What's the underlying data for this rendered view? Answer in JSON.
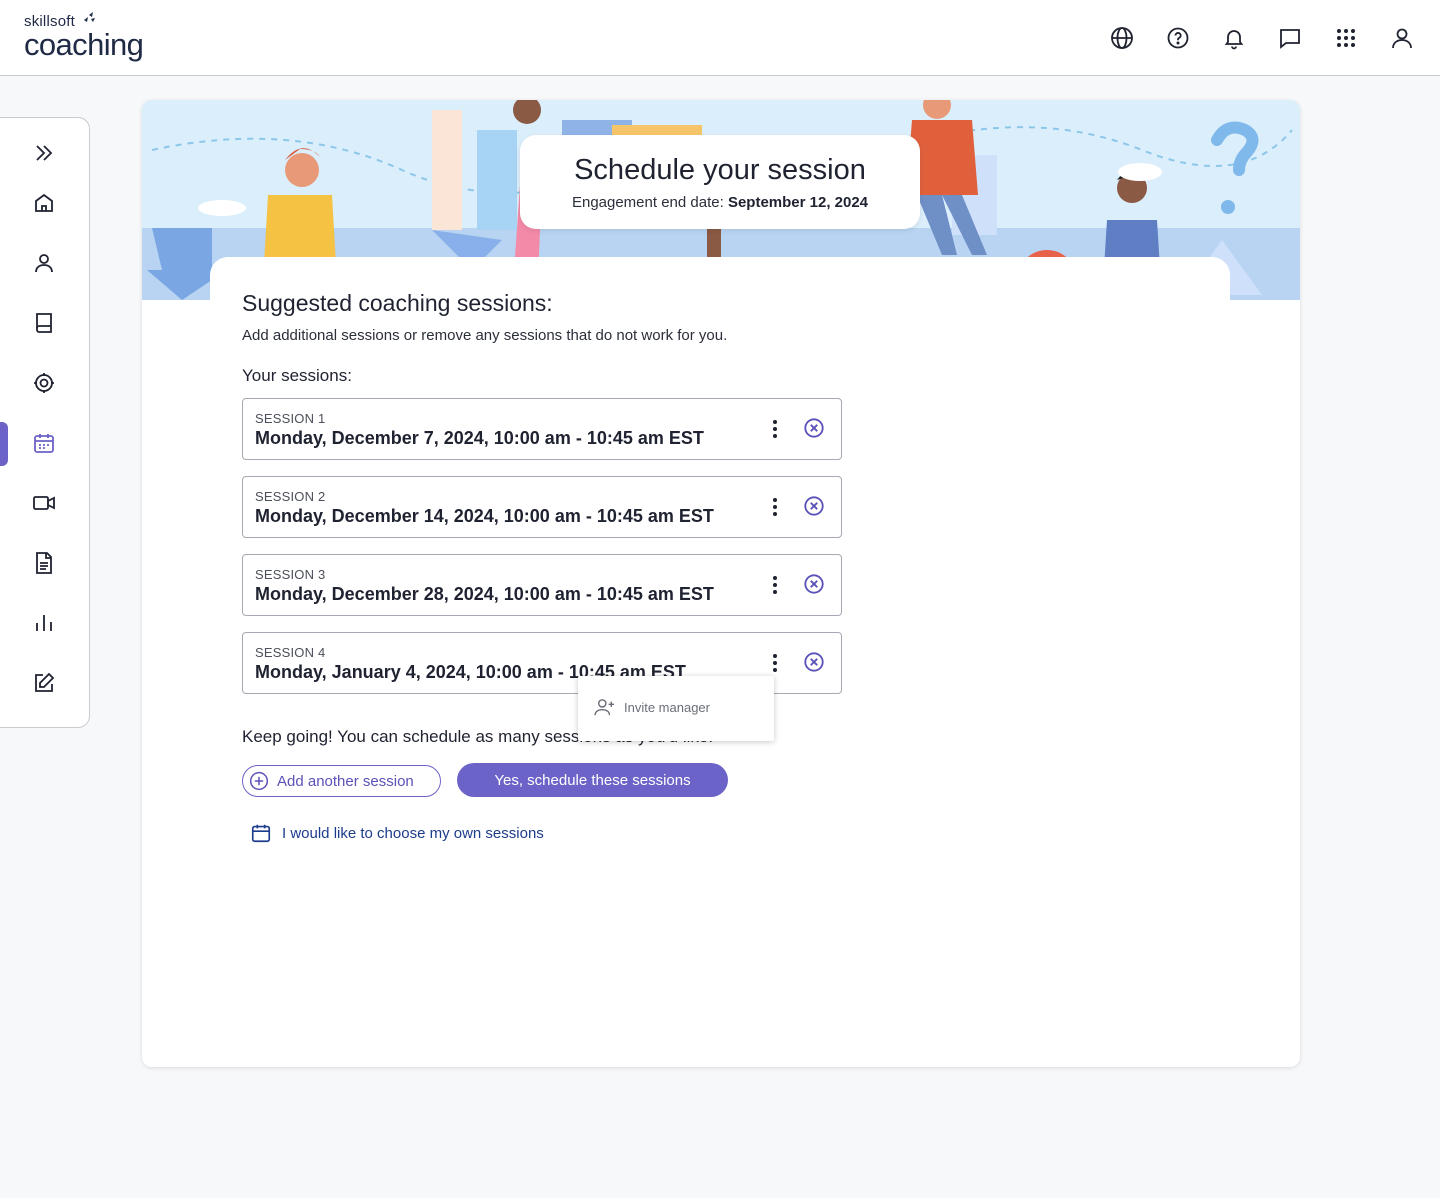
{
  "app": {
    "brand_small": "skillsoft",
    "brand_big": "coaching"
  },
  "topbar": {
    "icons": [
      "globe-icon",
      "help-icon",
      "bell-icon",
      "chat-icon",
      "apps-grid-icon",
      "user-icon"
    ]
  },
  "sidebar": {
    "items": [
      "expand-icon",
      "home-icon",
      "person-icon",
      "book-icon",
      "target-icon",
      "calendar-icon",
      "video-icon",
      "document-icon",
      "chart-icon",
      "edit-icon"
    ],
    "active": "calendar-icon"
  },
  "header": {
    "title": "Schedule your session",
    "engagement_label": "Engagement end date:",
    "engagement_date": "September 12, 2024"
  },
  "main": {
    "heading": "Suggested coaching sessions:",
    "hint": "Add additional sessions or remove any sessions that do not work for you.",
    "your_sessions": "Your sessions:",
    "sessions": [
      {
        "label": "SESSION 1",
        "when": "Monday, December 7, 2024, 10:00 am - 10:45 am EST"
      },
      {
        "label": "SESSION 2",
        "when": "Monday, December 14, 2024, 10:00 am - 10:45 am EST"
      },
      {
        "label": "SESSION 3",
        "when": "Monday, December 28, 2024, 10:00 am - 10:45 am EST"
      },
      {
        "label": "SESSION 4",
        "when": "Monday, January 4, 2024, 10:00 am - 10:45 am EST"
      }
    ],
    "menu_item": "Invite manager",
    "keep_going": "Keep going! You can schedule as many sessions as you'd like.",
    "add_session": "Add another session",
    "schedule": "Yes, schedule these sessions",
    "own_sessions": "I would like to choose my own sessions"
  },
  "colors": {
    "accent": "#6b63c7",
    "link": "#1c3c8c",
    "hero_bg": "#d7ecfb"
  }
}
